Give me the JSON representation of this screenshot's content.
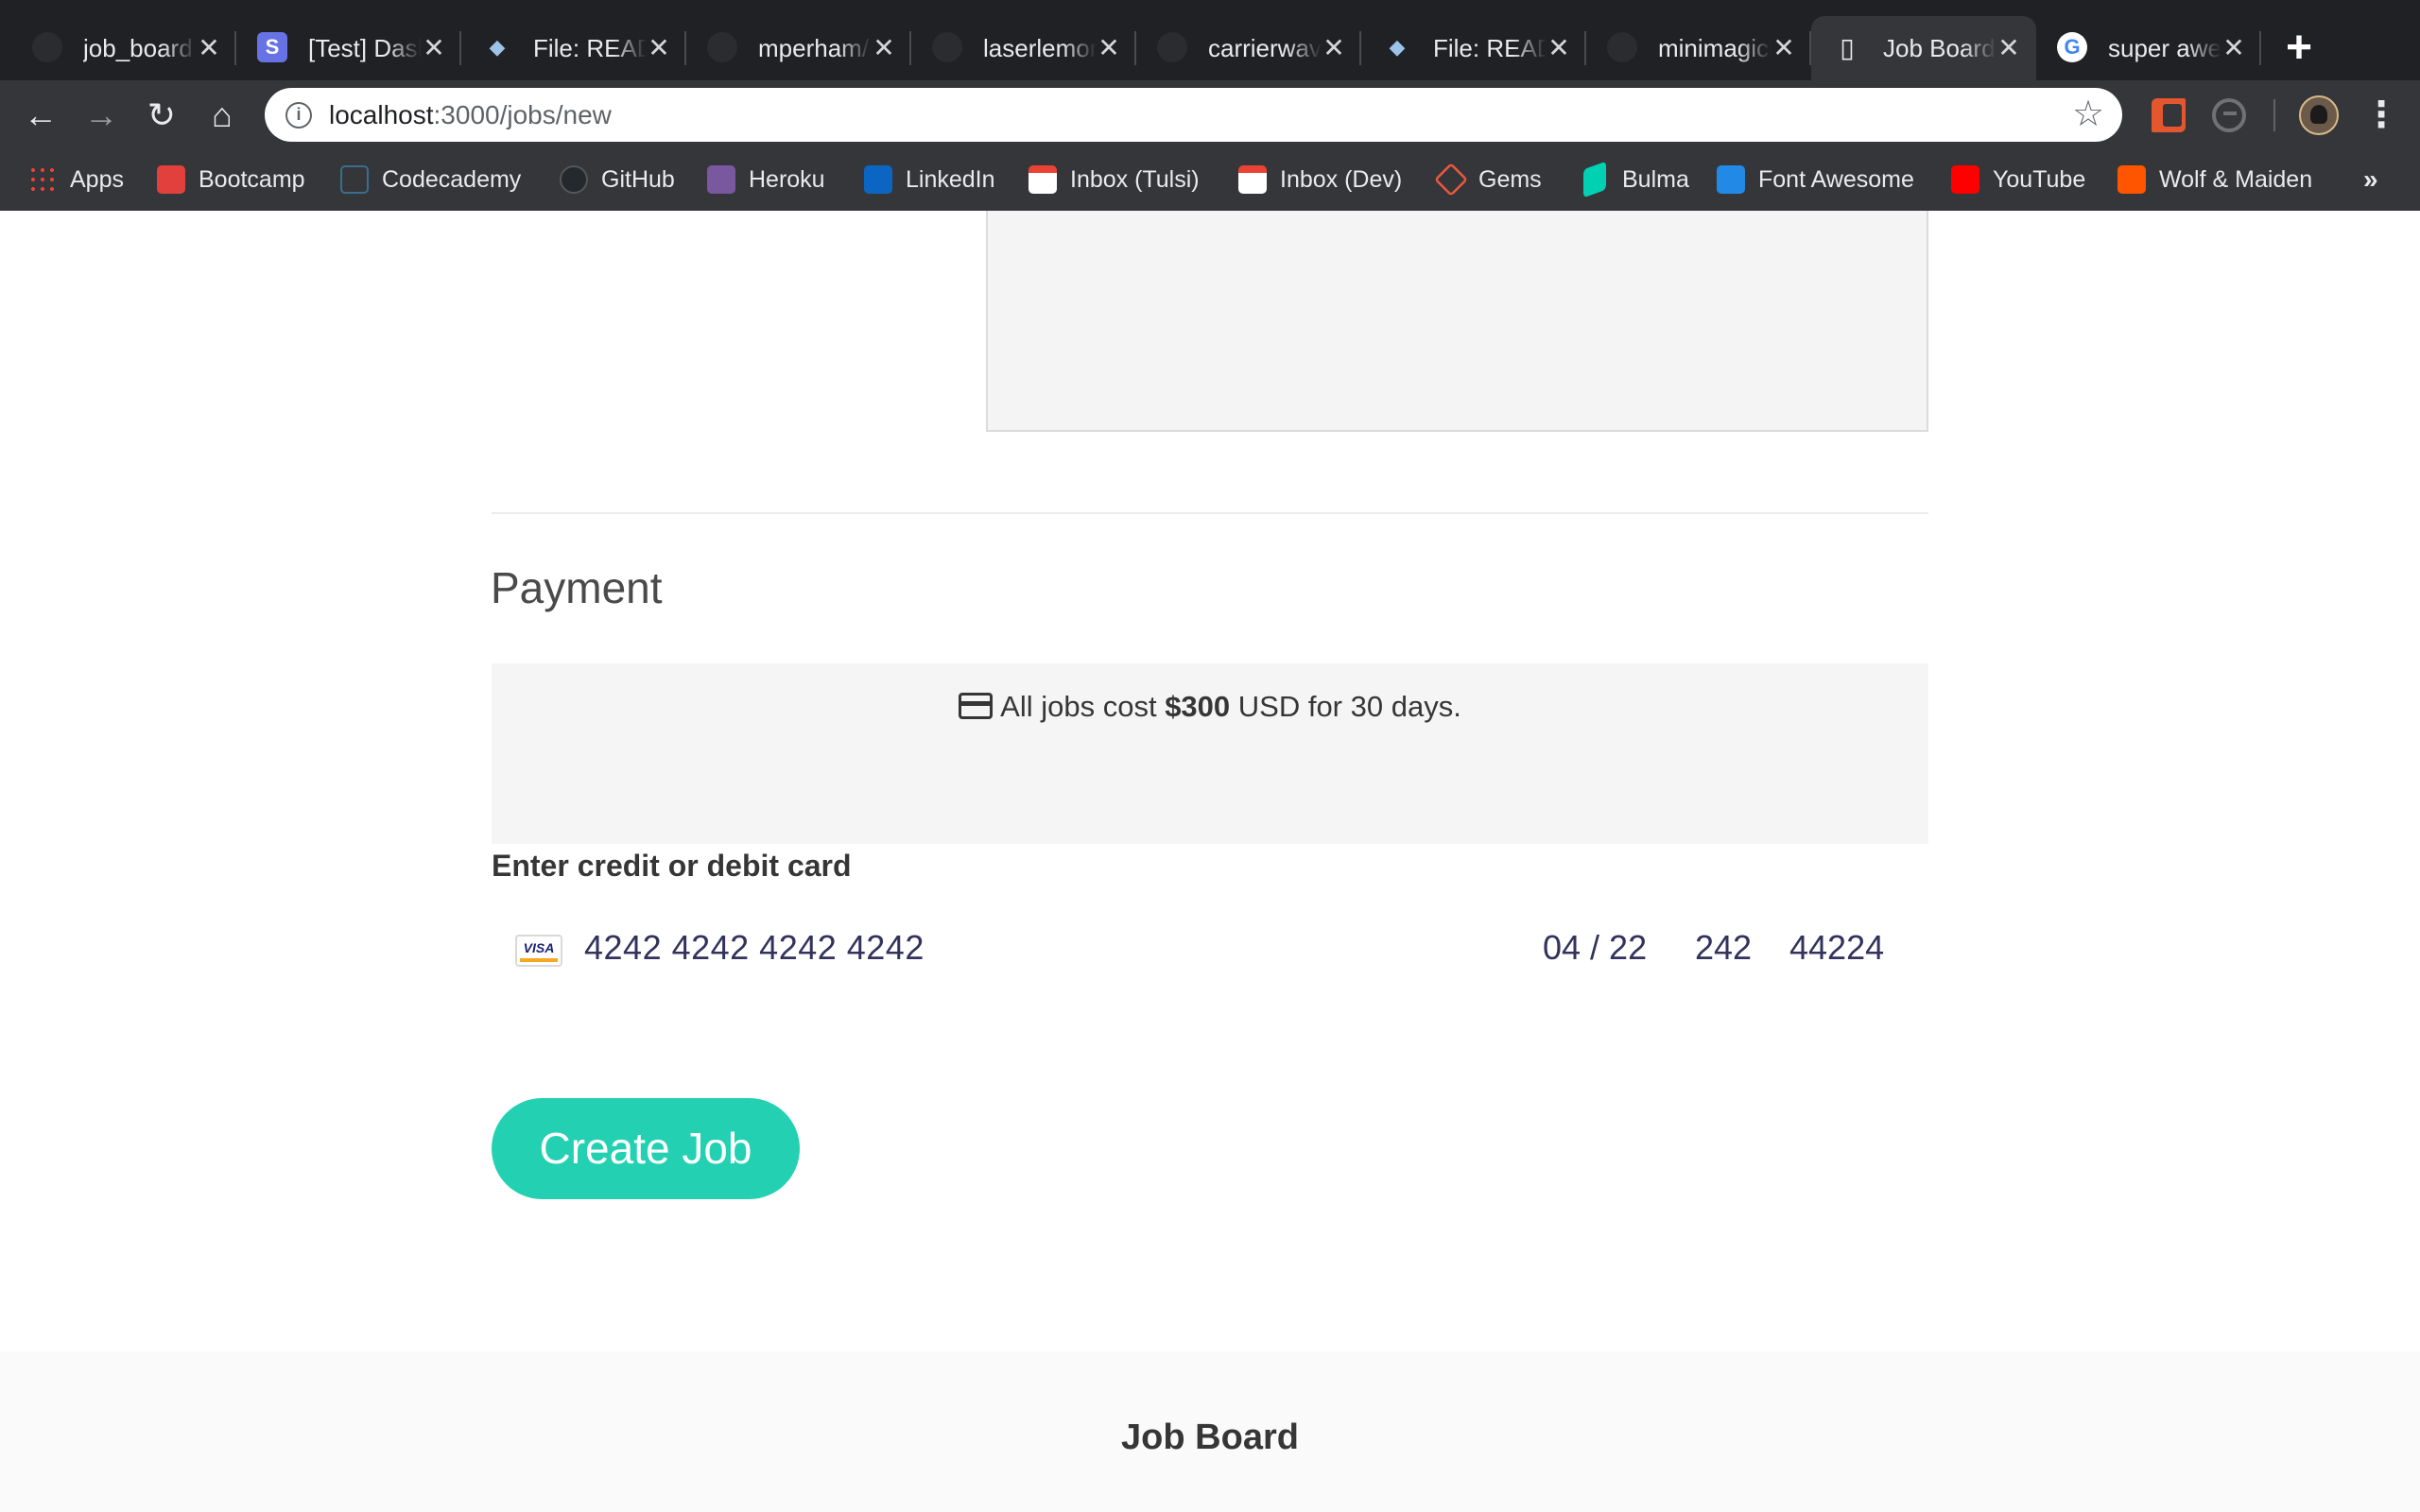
{
  "browser": {
    "tabs": [
      {
        "title": "job_board",
        "icon": "github-icon"
      },
      {
        "title": "[Test] Dashboard",
        "icon": "stripe-icon"
      },
      {
        "title": "File: README",
        "icon": "rubydoc-icon"
      },
      {
        "title": "mperham/sidekiq",
        "icon": "github-icon"
      },
      {
        "title": "laserlemon/figaro",
        "icon": "github-icon"
      },
      {
        "title": "carrierwaveuploader",
        "icon": "github-icon"
      },
      {
        "title": "File: README",
        "icon": "rubydoc-icon"
      },
      {
        "title": "minimagick",
        "icon": "github-icon"
      },
      {
        "title": "Job Board",
        "icon": "page-icon",
        "active": true
      },
      {
        "title": "super awesome",
        "icon": "google-icon"
      }
    ],
    "close_glyph": "✕",
    "new_tab_glyph": "+",
    "address": {
      "host": "localhost",
      "path": ":3000/jobs/new"
    },
    "bookmarks": [
      {
        "label": "Apps",
        "icon": "apps-grid-icon",
        "color": "#e94235"
      },
      {
        "label": "Bootcamp",
        "icon": "bootcamp-icon",
        "color": "#e2403c"
      },
      {
        "label": "Codecademy",
        "icon": "codecademy-icon",
        "color": "#1f4056"
      },
      {
        "label": "GitHub",
        "icon": "github-icon",
        "color": "#24292e"
      },
      {
        "label": "Heroku",
        "icon": "heroku-icon",
        "color": "#79589f"
      },
      {
        "label": "LinkedIn",
        "icon": "linkedin-icon",
        "color": "#0a66c2"
      },
      {
        "label": "Inbox (Tulsi)",
        "icon": "gmail-icon",
        "color": "#ea4335"
      },
      {
        "label": "Inbox (Dev)",
        "icon": "gmail-icon",
        "color": "#ea4335"
      },
      {
        "label": "Gems",
        "icon": "rubygems-icon",
        "color": "#e9573f"
      },
      {
        "label": "Bulma",
        "icon": "bulma-icon",
        "color": "#00d1b2"
      },
      {
        "label": "Font Awesome",
        "icon": "font-awesome-icon",
        "color": "#228ae6"
      },
      {
        "label": "YouTube",
        "icon": "youtube-icon",
        "color": "#ff0000"
      },
      {
        "label": "Wolf & Maiden",
        "icon": "soundcloud-icon",
        "color": "#ff5500"
      }
    ],
    "bookmarks_overflow": "»"
  },
  "page": {
    "payment_heading": "Payment",
    "notice": {
      "prefix": "All jobs cost ",
      "price": "$300",
      "suffix": " USD for 30 days."
    },
    "card_label": "Enter credit or debit card",
    "card": {
      "brand": "VISA",
      "number": "4242 4242 4242 4242",
      "expiry": "04 / 22",
      "cvc": "242",
      "zip": "44224"
    },
    "submit_label": "Create Job",
    "footer_brand": "Job Board"
  },
  "colors": {
    "accent": "#23d1b2",
    "tabstrip": "#202124",
    "toolbar": "#35363a"
  }
}
